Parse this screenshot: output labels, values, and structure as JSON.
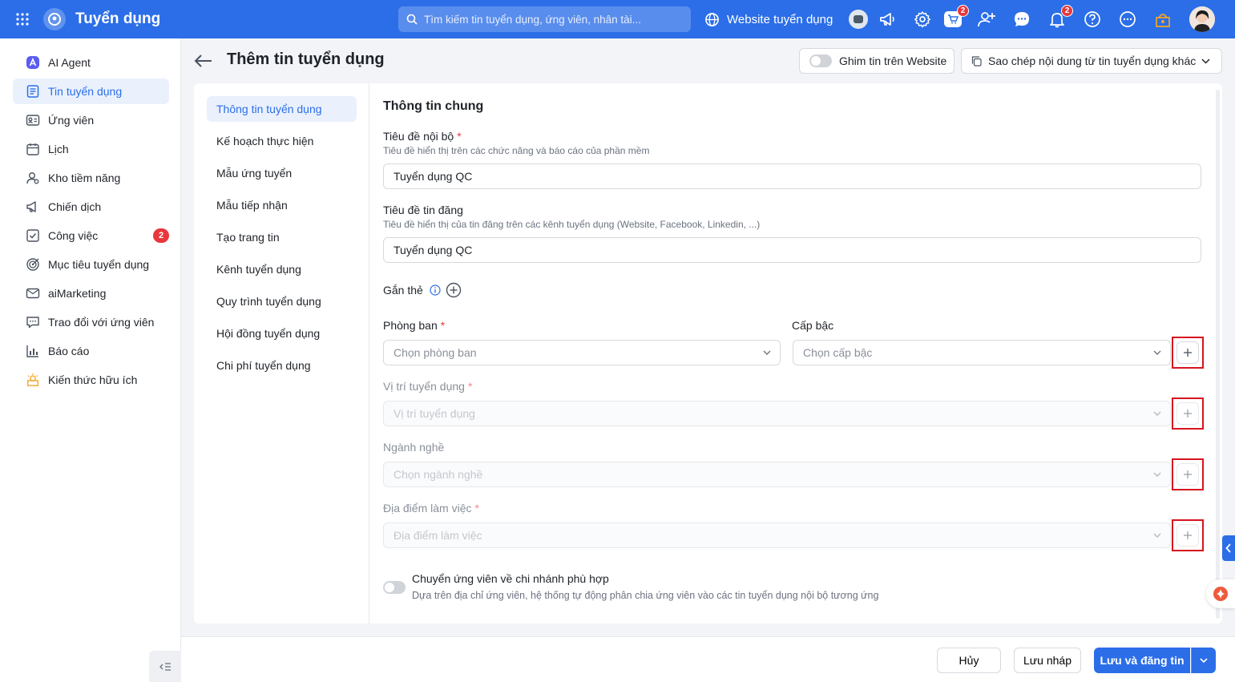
{
  "app": {
    "title": "Tuyển dụng",
    "search_placeholder": "Tìm kiếm tin tuyển dụng, ứng viên, nhân tài...",
    "website_label": "Website tuyển dụng",
    "cart_badge": "2",
    "notif_badge": "2",
    "accent": "#2b6ee8"
  },
  "sidebar": {
    "items": [
      {
        "label": "AI Agent",
        "icon": "ai-agent-icon"
      },
      {
        "label": "Tin tuyển dụng",
        "icon": "job-post-icon",
        "active": true
      },
      {
        "label": "Ứng viên",
        "icon": "candidate-icon"
      },
      {
        "label": "Lịch",
        "icon": "calendar-icon"
      },
      {
        "label": "Kho tiềm năng",
        "icon": "talent-pool-icon"
      },
      {
        "label": "Chiến dịch",
        "icon": "campaign-icon"
      },
      {
        "label": "Công việc",
        "icon": "task-icon",
        "badge": "2"
      },
      {
        "label": "Mục tiêu tuyển dụng",
        "icon": "target-icon"
      },
      {
        "label": "aiMarketing",
        "icon": "mail-icon"
      },
      {
        "label": "Trao đổi với ứng viên",
        "icon": "chat-icon"
      },
      {
        "label": "Báo cáo",
        "icon": "report-icon"
      },
      {
        "label": "Kiến thức hữu ích",
        "icon": "bulb-icon"
      }
    ]
  },
  "header": {
    "title": "Thêm tin tuyển dụng",
    "pin_label": "Ghim tin trên Website",
    "copy_label": "Sao chép nội dung từ tin tuyển dụng khác"
  },
  "steps": [
    "Thông tin tuyển dụng",
    "Kế hoạch thực hiện",
    "Mẫu ứng tuyển",
    "Mẫu tiếp nhận",
    "Tạo trang tin",
    "Kênh tuyển dụng",
    "Quy trình tuyển dụng",
    "Hội đồng tuyển dụng",
    "Chi phí tuyển dụng"
  ],
  "form": {
    "section_title": "Thông tin chung",
    "internal_title": {
      "label": "Tiêu đề nội bộ",
      "hint": "Tiêu đề hiển thị trên các chức năng và báo cáo của phần mềm",
      "value": "Tuyển dụng QC"
    },
    "post_title": {
      "label": "Tiêu đề tin đăng",
      "hint": "Tiêu đề hiển thị của tin đăng trên các kênh tuyển dụng (Website, Facebook, Linkedin, ...)",
      "value": "Tuyển dụng QC"
    },
    "tags_label": "Gắn thẻ",
    "department": {
      "label": "Phòng ban",
      "placeholder": "Chọn phòng ban"
    },
    "level": {
      "label": "Cấp bậc",
      "placeholder": "Chọn cấp bậc"
    },
    "position": {
      "label": "Vị trí tuyển dụng",
      "placeholder": "Vị trí tuyển dụng"
    },
    "industry": {
      "label": "Ngành nghề",
      "placeholder": "Chọn ngành nghề"
    },
    "location": {
      "label": "Địa điểm làm việc",
      "placeholder": "Địa điểm làm việc"
    },
    "branch_toggle": {
      "label": "Chuyển ứng viên về chi nhánh phù hợp",
      "hint": "Dựa trên địa chỉ ứng viên, hệ thống tự động phân chia ứng viên vào các tin tuyển dụng nội bộ tương ứng"
    }
  },
  "footer": {
    "cancel": "Hủy",
    "draft": "Lưu nháp",
    "save_publish": "Lưu và đăng tin"
  }
}
